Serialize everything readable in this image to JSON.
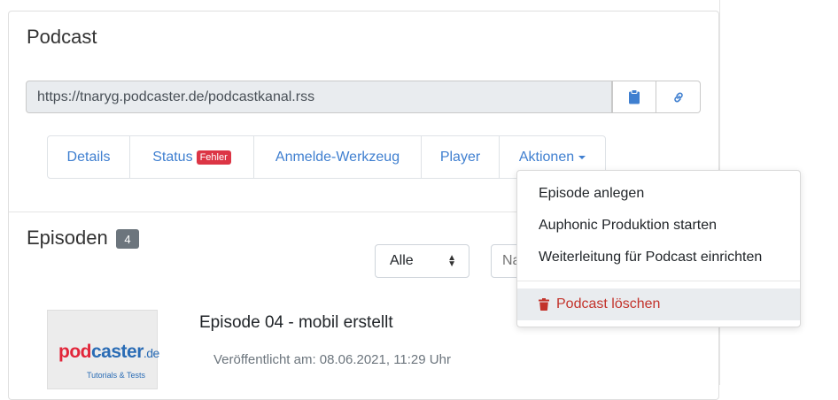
{
  "card": {
    "title": "Podcast",
    "feed_url": "https://tnaryg.podcaster.de/podcastkanal.rss",
    "copy_button_icon": "clipboard-icon",
    "link_button_icon": "link-icon"
  },
  "tabs": [
    {
      "label": "Details"
    },
    {
      "label": "Status",
      "badge": "Fehler"
    },
    {
      "label": "Anmelde-Werkzeug"
    },
    {
      "label": "Player"
    },
    {
      "label": "Aktionen"
    }
  ],
  "actions_menu": {
    "items": [
      {
        "label": "Episode anlegen"
      },
      {
        "label": "Auphonic Produktion starten"
      },
      {
        "label": "Weiterleitung für Podcast einrichten"
      }
    ],
    "danger_item": {
      "label": "Podcast löschen",
      "icon": "trash-icon"
    }
  },
  "episodes": {
    "title": "Episoden",
    "count": "4",
    "filter_selected": "Alle",
    "search_placeholder": "Na",
    "list": [
      {
        "title": "Episode 04 - mobil erstellt",
        "published": "Veröffentlicht am: 08.06.2021, 11:29 Uhr",
        "thumbnail": {
          "logo_pod": "pod",
          "logo_caster": "caster",
          "logo_tld": ".de",
          "tagline": "Tutorials & Tests"
        }
      }
    ]
  },
  "colors": {
    "link": "#3f7fd0",
    "danger": "#c3332b",
    "badge_error": "#dc3545",
    "badge_count": "#6c757d"
  }
}
